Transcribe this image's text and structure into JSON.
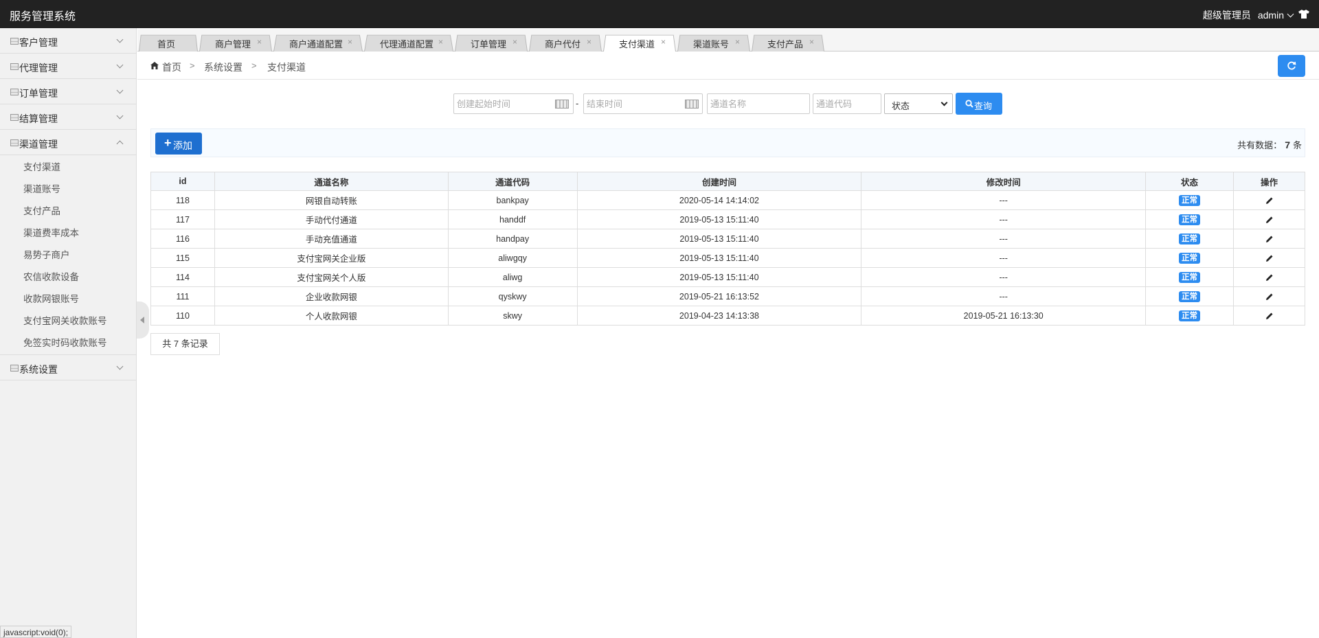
{
  "app": {
    "title": "服务管理系统"
  },
  "header": {
    "role": "超级管理员",
    "user": "admin"
  },
  "sidebar": {
    "groups": [
      {
        "label": "客户管理",
        "expanded": false
      },
      {
        "label": "代理管理",
        "expanded": false
      },
      {
        "label": "订单管理",
        "expanded": false
      },
      {
        "label": "结算管理",
        "expanded": false
      },
      {
        "label": "渠道管理",
        "expanded": true
      },
      {
        "label": "系统设置",
        "expanded": false
      }
    ],
    "channel_items": [
      "支付渠道",
      "渠道账号",
      "支付产品",
      "渠道费率成本",
      "易势子商户",
      "农信收款设备",
      "收款网银账号",
      "支付宝网关收款账号",
      "免签实时码收款账号"
    ]
  },
  "tabs": [
    {
      "label": "首页",
      "closable": false
    },
    {
      "label": "商户管理",
      "closable": true
    },
    {
      "label": "商户通道配置",
      "closable": true
    },
    {
      "label": "代理通道配置",
      "closable": true
    },
    {
      "label": "订单管理",
      "closable": true
    },
    {
      "label": "商户代付",
      "closable": true
    },
    {
      "label": "支付渠道",
      "closable": true,
      "active": true
    },
    {
      "label": "渠道账号",
      "closable": true
    },
    {
      "label": "支付产品",
      "closable": true
    }
  ],
  "tab_close_glyph": "×",
  "breadcrumb": {
    "home": "首页",
    "sep": ">",
    "level1": "系统设置",
    "level2": "支付渠道"
  },
  "search": {
    "start_placeholder": "创建起始时间",
    "dash": "-",
    "end_placeholder": "结束时间",
    "name_placeholder": "通道名称",
    "code_placeholder": "通道代码",
    "status_value": "状态",
    "query_label": "查询"
  },
  "toolbar": {
    "add_plus": "+",
    "add_label": "添加",
    "total_prefix": "共有数据：",
    "total_count": "7",
    "total_suffix": "条"
  },
  "table": {
    "columns": [
      "id",
      "通道名称",
      "通道代码",
      "创建时间",
      "修改时间",
      "状态",
      "操作"
    ],
    "rows": [
      {
        "id": "118",
        "name": "网银自动转账",
        "code": "bankpay",
        "created": "2020-05-14 14:14:02",
        "modified": "---",
        "status": "正常"
      },
      {
        "id": "117",
        "name": "手动代付通道",
        "code": "handdf",
        "created": "2019-05-13 15:11:40",
        "modified": "---",
        "status": "正常"
      },
      {
        "id": "116",
        "name": "手动充值通道",
        "code": "handpay",
        "created": "2019-05-13 15:11:40",
        "modified": "---",
        "status": "正常"
      },
      {
        "id": "115",
        "name": "支付宝网关企业版",
        "code": "aliwgqy",
        "created": "2019-05-13 15:11:40",
        "modified": "---",
        "status": "正常"
      },
      {
        "id": "114",
        "name": "支付宝网关个人版",
        "code": "aliwg",
        "created": "2019-05-13 15:11:40",
        "modified": "---",
        "status": "正常"
      },
      {
        "id": "111",
        "name": "企业收款网银",
        "code": "qyskwy",
        "created": "2019-05-21 16:13:52",
        "modified": "---",
        "status": "正常"
      },
      {
        "id": "110",
        "name": "个人收款网银",
        "code": "skwy",
        "created": "2019-04-23 14:13:38",
        "modified": "2019-05-21 16:13:30",
        "status": "正常"
      }
    ]
  },
  "pagination": {
    "summary": "共 7 条记录"
  },
  "status_bar": {
    "url": "javascript:void(0);"
  },
  "colors": {
    "topbar": "#222222",
    "primary": "#2d8cf0",
    "add_button": "#1e6fd0",
    "sidebar": "#f1f1f1"
  },
  "icons": [
    "shirt-icon",
    "home-icon",
    "refresh-icon",
    "calendar-icon",
    "search-icon",
    "pencil-icon",
    "chevron-down-icon",
    "chevron-up-icon",
    "folder-icon",
    "collapse-arrow-icon"
  ]
}
